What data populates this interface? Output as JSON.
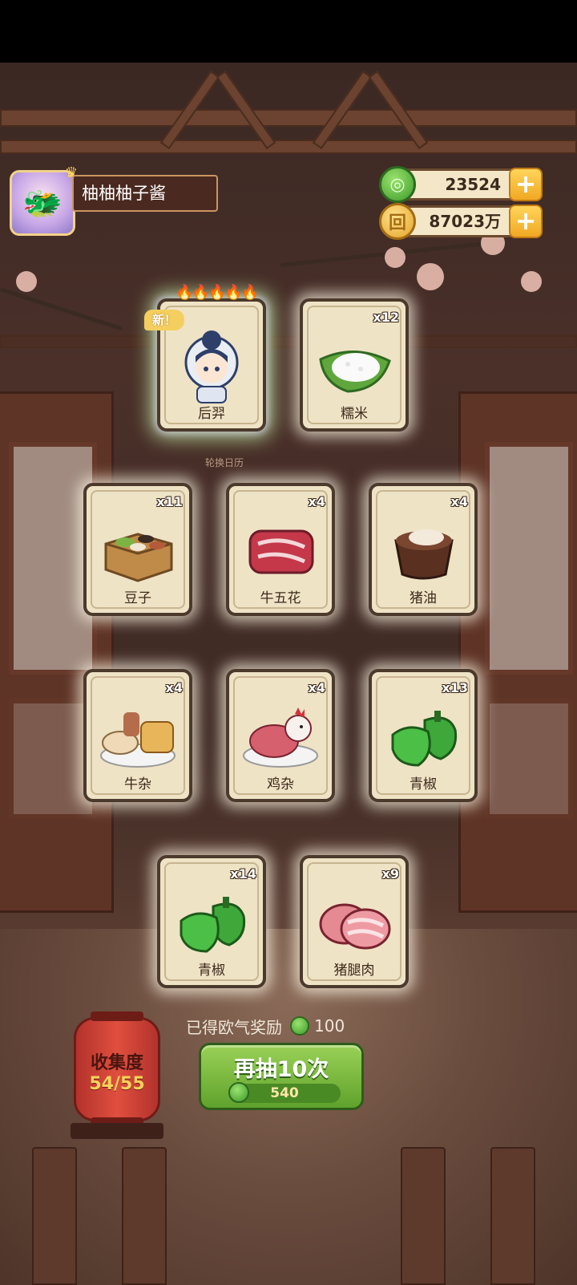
{
  "player": {
    "name": "柚柚柚子酱"
  },
  "currency": {
    "jade": {
      "value": "23524",
      "icon": "jade-icon"
    },
    "coin": {
      "value": "87023万",
      "icon": "coin-icon"
    },
    "plus": "+"
  },
  "cards": [
    {
      "id": "houyi",
      "label": "后羿",
      "count": "",
      "new_tag": "新！",
      "special": true
    },
    {
      "id": "glutinous-rice",
      "label": "糯米",
      "count": "x12"
    },
    {
      "id": "beans",
      "label": "豆子",
      "count": "x11"
    },
    {
      "id": "beef-belly",
      "label": "牛五花",
      "count": "x4"
    },
    {
      "id": "lard",
      "label": "猪油",
      "count": "x4"
    },
    {
      "id": "beef-offal",
      "label": "牛杂",
      "count": "x4"
    },
    {
      "id": "chicken-offal",
      "label": "鸡杂",
      "count": "x4"
    },
    {
      "id": "green-pepper-1",
      "label": "青椒",
      "count": "x13"
    },
    {
      "id": "green-pepper-2",
      "label": "青椒",
      "count": "x14"
    },
    {
      "id": "pork-leg",
      "label": "猪腿肉",
      "count": "x9"
    }
  ],
  "calendar_text": "轮换日历",
  "reward": {
    "label": "已得欧气奖励",
    "value": "100"
  },
  "draw_button": {
    "label": "再抽10次",
    "cost": "540"
  },
  "collection": {
    "label": "收集度",
    "progress": "54/55"
  }
}
